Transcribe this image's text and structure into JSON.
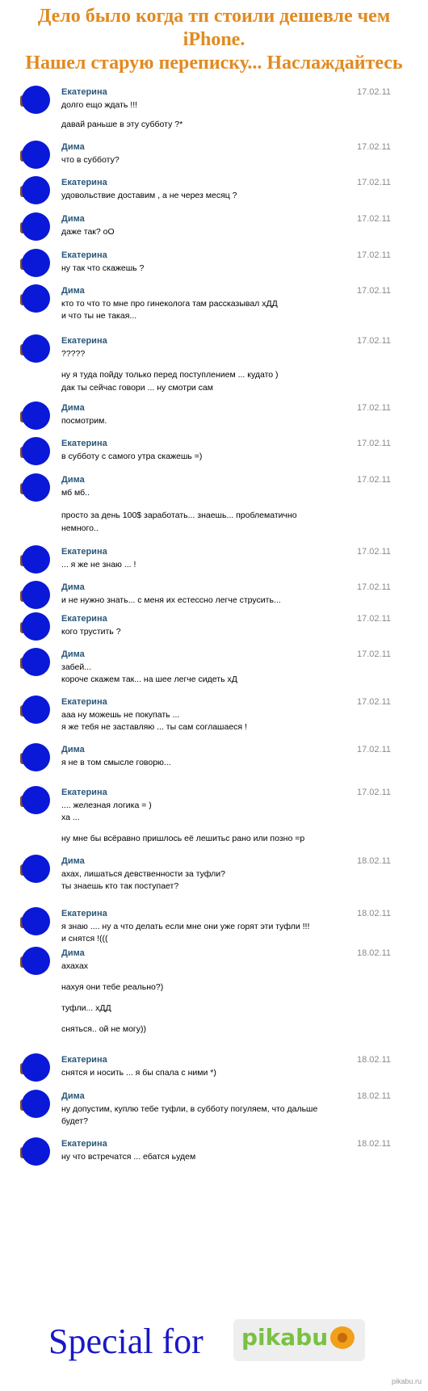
{
  "header": {
    "title_lines": [
      "Дело было когда тп стоили дешевле чем",
      "iPhone.",
      "Нашел старую переписку... Наслаждайтесь"
    ]
  },
  "messages": [
    {
      "name": "Екатерина",
      "date": "17.02.11",
      "lines": [
        "долго ещо ждать !!!",
        "давай раньше в эту субботу ?*"
      ]
    },
    {
      "name": "Дима",
      "date": "17.02.11",
      "lines": [
        "что в субботу?"
      ]
    },
    {
      "name": "Екатерина",
      "date": "17.02.11",
      "lines": [
        "удовольствие доставим , а не через месяц ?"
      ]
    },
    {
      "name": "Дима",
      "date": "17.02.11",
      "lines": [
        "даже так? оО"
      ]
    },
    {
      "name": "Екатерина",
      "date": "17.02.11",
      "lines": [
        "ну так что скажешь ?"
      ]
    },
    {
      "name": "Дима",
      "date": "17.02.11",
      "lines": [
        "кто то что то мне про гинеколога там рассказывал хДД",
        "и что ты не такая..."
      ]
    },
    {
      "name": "Екатерина",
      "date": "17.02.11",
      "lines": [
        "?????",
        "ну я туда пойду только перед поступлением ... кудато )",
        "дак ты сейчас говори ... ну смотри сам"
      ]
    },
    {
      "name": "Дима",
      "date": "17.02.11",
      "lines": [
        "посмотрим."
      ]
    },
    {
      "name": "Екатерина",
      "date": "17.02.11",
      "lines": [
        "в субботу с самого утра скажешь =)"
      ]
    },
    {
      "name": "Дима",
      "date": "17.02.11",
      "lines": [
        "мб мб..",
        "просто за день 100$ заработать... знаешь... проблематично",
        "немного.."
      ]
    },
    {
      "name": "Екатерина",
      "date": "17.02.11",
      "lines": [
        "... я же не знаю ... !"
      ]
    },
    {
      "name": "Дима",
      "date": "17.02.11",
      "lines": [
        "и не нужно знать... с меня их естессно легче струсить..."
      ]
    },
    {
      "name": "Екатерина",
      "date": "17.02.11",
      "lines": [
        "кого трустить ?"
      ]
    },
    {
      "name": "Дима",
      "date": "17.02.11",
      "lines": [
        "забей...",
        "короче скажем так... на шее легче сидеть хД"
      ]
    },
    {
      "name": "Екатерина",
      "date": "17.02.11",
      "lines": [
        "ааа ну можешь не покупать ...",
        "я же тебя не заставляю ... ты сам соглашаеся !"
      ]
    },
    {
      "name": "Дима",
      "date": "17.02.11",
      "lines": [
        "я не в том смысле говорю..."
      ]
    },
    {
      "name": "Екатерина",
      "date": "17.02.11",
      "lines": [
        ".... железная логика = )",
        "ха ...",
        "ну мне бы всёравно пришлось её лешитьс рано или позно =р"
      ]
    },
    {
      "name": "Дима",
      "date": "18.02.11",
      "lines": [
        "ахах, лишаться девственности за туфли?",
        "ты знаешь кто так поступает?"
      ]
    },
    {
      "name": "Екатерина",
      "date": "18.02.11",
      "lines": [
        "я знаю .... ну а что делать если мне они уже горят эти туфли !!!",
        "и снятся !((("
      ]
    },
    {
      "name": "Дима",
      "date": "18.02.11",
      "lines": [
        "ахахах",
        "нахуя они тебе реально?)",
        "туфли... хДД",
        "сняться.. ой не могу))"
      ]
    },
    {
      "name": "Екатерина",
      "date": "18.02.11",
      "lines": [
        "снятся и носить ... я бы спала с ними *)"
      ]
    },
    {
      "name": "Дима",
      "date": "18.02.11",
      "lines": [
        "ну допустим, куплю тебе туфли, в субботу погуляем, что дальше",
        "будет?"
      ]
    },
    {
      "name": "Екатерина",
      "date": "18.02.11",
      "lines": [
        "ну что встречатся ... ебатся ьудем"
      ]
    }
  ],
  "footer": {
    "special_text": "Special for",
    "logo_text": "pikabu",
    "watermark": "pikabu.ru"
  },
  "colors": {
    "title": "#e28a1f",
    "name": "#2b587a",
    "avatar": "#0a18d8",
    "footer_text": "#1818c8",
    "logo_green": "#79c142"
  }
}
